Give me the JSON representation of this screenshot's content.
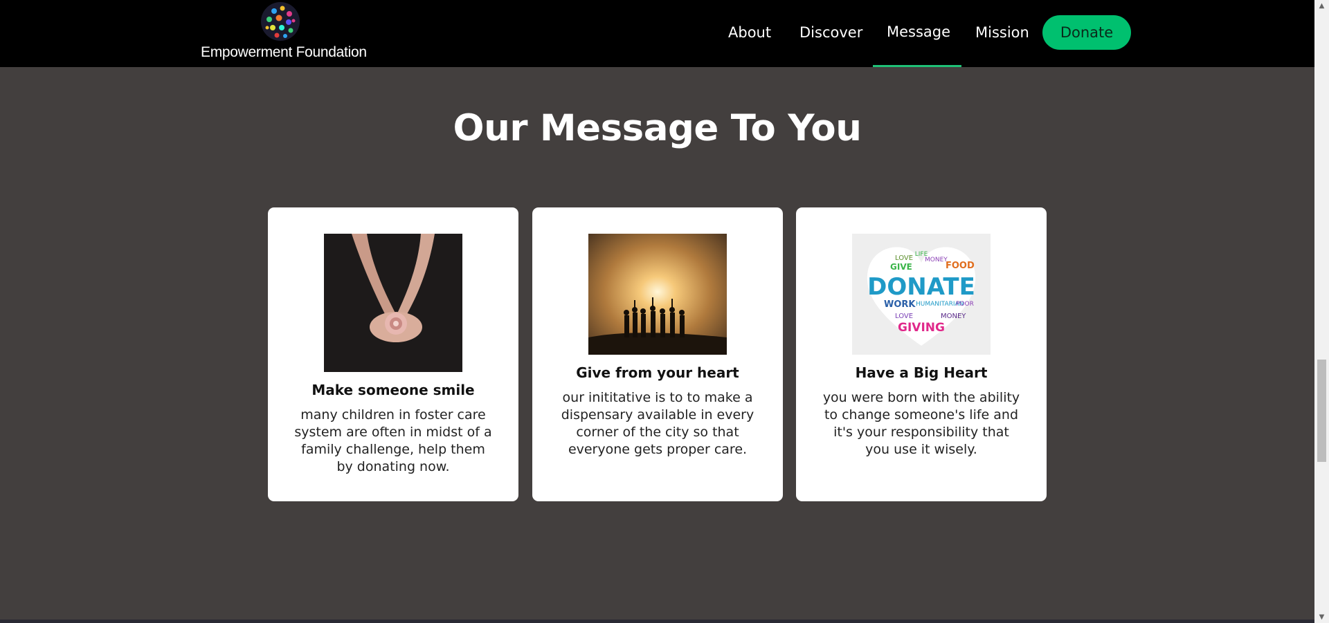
{
  "brand": {
    "name": "Empowerment Foundation"
  },
  "nav": {
    "items": [
      {
        "label": "About"
      },
      {
        "label": "Discover"
      },
      {
        "label": "Message"
      },
      {
        "label": "Mission"
      }
    ],
    "active": "Message",
    "donate_label": "Donate"
  },
  "section": {
    "title": "Our Message To You"
  },
  "cards": [
    {
      "title": "Make someone smile",
      "text": "many children in foster care system are often in midst of a family challenge, help them by donating now."
    },
    {
      "title": "Give from your heart",
      "text": "our inititative is to to make a dispensary available in every corner of the city so that everyone gets proper care."
    },
    {
      "title": "Have a Big Heart",
      "text": "you were born with the ability to change someone's life and it's your responsibility that you use it wisely.",
      "image_words": [
        "LIFE",
        "LOVE",
        "GIVE",
        "MONEY",
        "FOOD",
        "DONATE",
        "WORK",
        "HUMANITARIAN",
        "POOR",
        "LOVE",
        "MONEY",
        "GIVING"
      ]
    }
  ],
  "colors": {
    "background": "#433f3e",
    "header": "#000000",
    "accent": "#00c06f",
    "card": "#ffffff"
  }
}
